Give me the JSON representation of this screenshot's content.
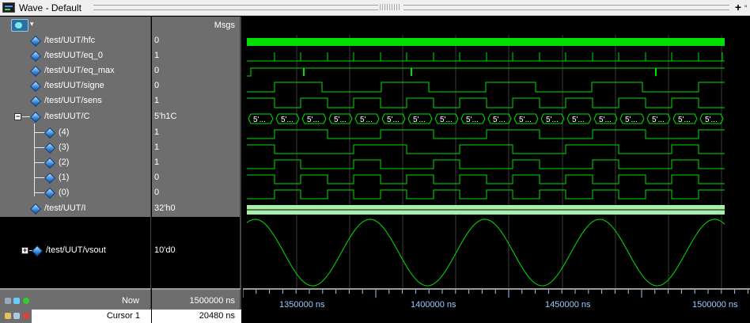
{
  "window": {
    "title": "Wave - Default"
  },
  "header": {
    "msgs_label": "Msgs",
    "chooser_arrow": "▾"
  },
  "signals": [
    {
      "name": "/test/UUT/hfc",
      "value": "0"
    },
    {
      "name": "/test/UUT/eq_0",
      "value": "1"
    },
    {
      "name": "/test/UUT/eq_max",
      "value": "0"
    },
    {
      "name": "/test/UUT/signe",
      "value": "0"
    },
    {
      "name": "/test/UUT/sens",
      "value": "1"
    },
    {
      "name": "/test/UUT/C",
      "value": "5'h1C"
    },
    {
      "name": "(4)",
      "value": "1"
    },
    {
      "name": "(3)",
      "value": "1"
    },
    {
      "name": "(2)",
      "value": "1"
    },
    {
      "name": "(1)",
      "value": "0"
    },
    {
      "name": "(0)",
      "value": "0"
    },
    {
      "name": "/test/UUT/I",
      "value": "32'h0"
    },
    {
      "name": "/test/UUT/vsout",
      "value": "10'd0"
    }
  ],
  "bus_label": "5'...",
  "cursor": {
    "now_label": "Now",
    "now_value": "1500000 ns",
    "cursor_label": "Cursor 1",
    "cursor_value": "20480 ns"
  },
  "timeline": {
    "labels": [
      "1350000 ns",
      "1400000 ns",
      "1450000 ns",
      "1500000 ns"
    ]
  },
  "colors": {
    "wave": "#00e000",
    "bus_fill": "#a8f0a8",
    "background": "#000000",
    "panel": "#6e6e6e",
    "timeline_text": "#99ccff"
  }
}
